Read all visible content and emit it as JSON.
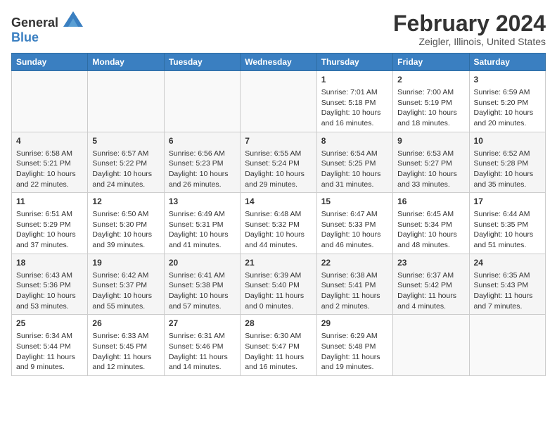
{
  "app": {
    "name_general": "General",
    "name_blue": "Blue"
  },
  "title": "February 2024",
  "subtitle": "Zeigler, Illinois, United States",
  "days_of_week": [
    "Sunday",
    "Monday",
    "Tuesday",
    "Wednesday",
    "Thursday",
    "Friday",
    "Saturday"
  ],
  "weeks": [
    [
      {
        "day": "",
        "info": ""
      },
      {
        "day": "",
        "info": ""
      },
      {
        "day": "",
        "info": ""
      },
      {
        "day": "",
        "info": ""
      },
      {
        "day": "1",
        "info": "Sunrise: 7:01 AM\nSunset: 5:18 PM\nDaylight: 10 hours\nand 16 minutes."
      },
      {
        "day": "2",
        "info": "Sunrise: 7:00 AM\nSunset: 5:19 PM\nDaylight: 10 hours\nand 18 minutes."
      },
      {
        "day": "3",
        "info": "Sunrise: 6:59 AM\nSunset: 5:20 PM\nDaylight: 10 hours\nand 20 minutes."
      }
    ],
    [
      {
        "day": "4",
        "info": "Sunrise: 6:58 AM\nSunset: 5:21 PM\nDaylight: 10 hours\nand 22 minutes."
      },
      {
        "day": "5",
        "info": "Sunrise: 6:57 AM\nSunset: 5:22 PM\nDaylight: 10 hours\nand 24 minutes."
      },
      {
        "day": "6",
        "info": "Sunrise: 6:56 AM\nSunset: 5:23 PM\nDaylight: 10 hours\nand 26 minutes."
      },
      {
        "day": "7",
        "info": "Sunrise: 6:55 AM\nSunset: 5:24 PM\nDaylight: 10 hours\nand 29 minutes."
      },
      {
        "day": "8",
        "info": "Sunrise: 6:54 AM\nSunset: 5:25 PM\nDaylight: 10 hours\nand 31 minutes."
      },
      {
        "day": "9",
        "info": "Sunrise: 6:53 AM\nSunset: 5:27 PM\nDaylight: 10 hours\nand 33 minutes."
      },
      {
        "day": "10",
        "info": "Sunrise: 6:52 AM\nSunset: 5:28 PM\nDaylight: 10 hours\nand 35 minutes."
      }
    ],
    [
      {
        "day": "11",
        "info": "Sunrise: 6:51 AM\nSunset: 5:29 PM\nDaylight: 10 hours\nand 37 minutes."
      },
      {
        "day": "12",
        "info": "Sunrise: 6:50 AM\nSunset: 5:30 PM\nDaylight: 10 hours\nand 39 minutes."
      },
      {
        "day": "13",
        "info": "Sunrise: 6:49 AM\nSunset: 5:31 PM\nDaylight: 10 hours\nand 41 minutes."
      },
      {
        "day": "14",
        "info": "Sunrise: 6:48 AM\nSunset: 5:32 PM\nDaylight: 10 hours\nand 44 minutes."
      },
      {
        "day": "15",
        "info": "Sunrise: 6:47 AM\nSunset: 5:33 PM\nDaylight: 10 hours\nand 46 minutes."
      },
      {
        "day": "16",
        "info": "Sunrise: 6:45 AM\nSunset: 5:34 PM\nDaylight: 10 hours\nand 48 minutes."
      },
      {
        "day": "17",
        "info": "Sunrise: 6:44 AM\nSunset: 5:35 PM\nDaylight: 10 hours\nand 51 minutes."
      }
    ],
    [
      {
        "day": "18",
        "info": "Sunrise: 6:43 AM\nSunset: 5:36 PM\nDaylight: 10 hours\nand 53 minutes."
      },
      {
        "day": "19",
        "info": "Sunrise: 6:42 AM\nSunset: 5:37 PM\nDaylight: 10 hours\nand 55 minutes."
      },
      {
        "day": "20",
        "info": "Sunrise: 6:41 AM\nSunset: 5:38 PM\nDaylight: 10 hours\nand 57 minutes."
      },
      {
        "day": "21",
        "info": "Sunrise: 6:39 AM\nSunset: 5:40 PM\nDaylight: 11 hours\nand 0 minutes."
      },
      {
        "day": "22",
        "info": "Sunrise: 6:38 AM\nSunset: 5:41 PM\nDaylight: 11 hours\nand 2 minutes."
      },
      {
        "day": "23",
        "info": "Sunrise: 6:37 AM\nSunset: 5:42 PM\nDaylight: 11 hours\nand 4 minutes."
      },
      {
        "day": "24",
        "info": "Sunrise: 6:35 AM\nSunset: 5:43 PM\nDaylight: 11 hours\nand 7 minutes."
      }
    ],
    [
      {
        "day": "25",
        "info": "Sunrise: 6:34 AM\nSunset: 5:44 PM\nDaylight: 11 hours\nand 9 minutes."
      },
      {
        "day": "26",
        "info": "Sunrise: 6:33 AM\nSunset: 5:45 PM\nDaylight: 11 hours\nand 12 minutes."
      },
      {
        "day": "27",
        "info": "Sunrise: 6:31 AM\nSunset: 5:46 PM\nDaylight: 11 hours\nand 14 minutes."
      },
      {
        "day": "28",
        "info": "Sunrise: 6:30 AM\nSunset: 5:47 PM\nDaylight: 11 hours\nand 16 minutes."
      },
      {
        "day": "29",
        "info": "Sunrise: 6:29 AM\nSunset: 5:48 PM\nDaylight: 11 hours\nand 19 minutes."
      },
      {
        "day": "",
        "info": ""
      },
      {
        "day": "",
        "info": ""
      }
    ]
  ]
}
